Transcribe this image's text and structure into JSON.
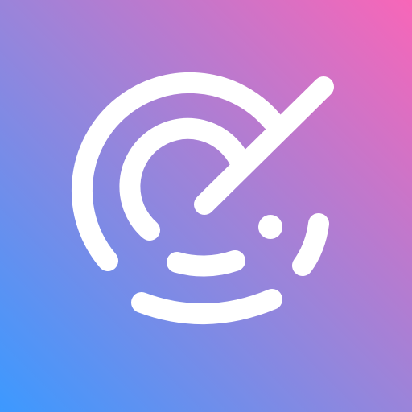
{
  "icon": {
    "name": "radar-icon",
    "colors": {
      "gradient_bottom_left": "#3C99FF",
      "gradient_mid": "#9A84DA",
      "gradient_top_right": "#F866B8",
      "glyph": "#FFFFFF"
    }
  }
}
